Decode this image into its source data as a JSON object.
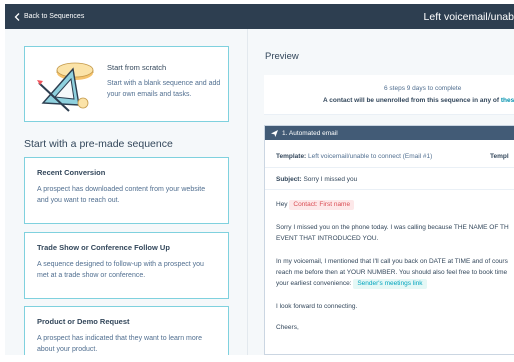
{
  "topbar": {
    "back_label": "Back to Sequences",
    "title": "Left voicemail/unab"
  },
  "left": {
    "scratch": {
      "title": "Start from scratch",
      "desc": "Start with a blank sequence and add your own emails and tasks."
    },
    "section_heading": "Start with a pre-made sequence",
    "templates": [
      {
        "title": "Recent Conversion",
        "desc": "A prospect has downloaded content from your website and you want to reach out."
      },
      {
        "title": "Trade Show or Conference Follow Up",
        "desc": "A sequence designed to follow-up with a prospect you met at a trade show or conference."
      },
      {
        "title": "Product or Demo Request",
        "desc": "A prospect has indicated that they want to learn more about your product."
      }
    ]
  },
  "preview": {
    "heading": "Preview",
    "steps_line": "6 steps   9 days to complete",
    "unenroll_text": "A contact will be unenrolled from this sequence in any of ",
    "unenroll_link": "thes",
    "email": {
      "header": "1. Automated email",
      "template_label": "Template:",
      "template_value": "Left voicemail/unable to connect (Email #1)",
      "template_right": "Templ",
      "subject_label": "Subject:",
      "subject_value": "Sorry I missed you",
      "greeting": "Hey",
      "contact_token": "Contact: First name",
      "para1_line1": "Sorry I missed you on the phone today. I was calling because THE NAME OF TH",
      "para1_line2": "EVENT THAT INTRODUCED YOU.",
      "para2_line1": "In my voicemail, I mentioned that I'll call you back on DATE at TIME and of cours",
      "para2_line2": "reach me before then at YOUR NUMBER. You should also feel free to book time",
      "para2_line3_prefix": "your earliest convenience:",
      "meetings_token": "Sender's meetings link",
      "para3": "I look forward to connecting.",
      "signoff": "Cheers,"
    }
  }
}
